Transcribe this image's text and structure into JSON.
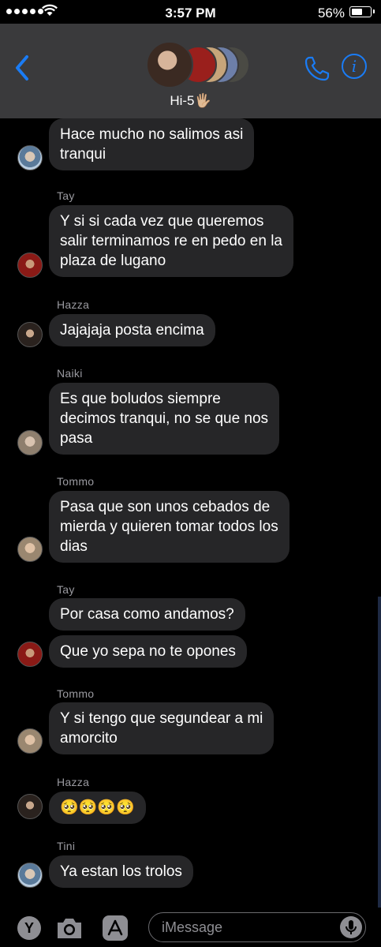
{
  "status_bar": {
    "time": "3:57 PM",
    "battery": "56%",
    "battery_level": 0.56
  },
  "header": {
    "title": "Hi-5🖐🏼"
  },
  "messages": [
    {
      "sender": "",
      "avatar": "tini",
      "bubbles": [
        "Hace mucho no salimos asi\ntranqui"
      ]
    },
    {
      "sender": "Tay",
      "avatar": "tay",
      "bubbles": [
        "Y si si cada vez que queremos\nsalir terminamos re en pedo en la\nplaza de lugano"
      ]
    },
    {
      "sender": "Hazza",
      "avatar": "hazza",
      "bubbles": [
        "Jajajaja posta encima"
      ]
    },
    {
      "sender": "Naiki",
      "avatar": "naiki",
      "bubbles": [
        "Es que boludos siempre\ndecimos tranqui, no se que nos\npasa"
      ]
    },
    {
      "sender": "Tommo",
      "avatar": "tommo",
      "bubbles": [
        "Pasa que son unos cebados de\nmierda y quieren tomar todos los\ndias"
      ]
    },
    {
      "sender": "Tay",
      "avatar": "tay",
      "bubbles": [
        "Por casa como andamos?",
        "Que yo sepa no te opones"
      ]
    },
    {
      "sender": "Tommo",
      "avatar": "tommo",
      "bubbles": [
        "Y si tengo que segundear a mi\namorcito"
      ]
    },
    {
      "sender": "Hazza",
      "avatar": "hazza",
      "bubbles": [
        "🥺🥺🥺🥺"
      ]
    },
    {
      "sender": "Tini",
      "avatar": "tini",
      "bubbles": [
        "Ya estan los trolos"
      ]
    }
  ],
  "composer": {
    "placeholder": "iMessage",
    "app_button": "Y"
  },
  "colors": {
    "accent": "#1a7cf5",
    "bubble": "#262628",
    "header": "#3a3a3c"
  }
}
